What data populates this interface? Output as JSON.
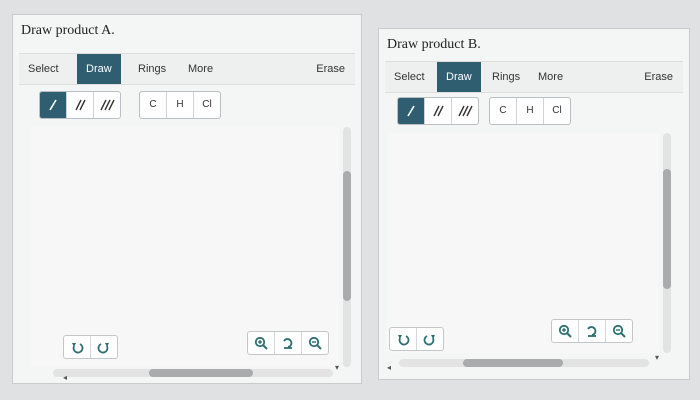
{
  "panels": [
    {
      "title": "Draw product A.",
      "tabs": [
        "Select",
        "Draw",
        "Rings",
        "More"
      ],
      "active_tab": "Draw",
      "erase": "Erase",
      "atoms": [
        "C",
        "H",
        "Cl"
      ]
    },
    {
      "title": "Draw product B.",
      "tabs": [
        "Select",
        "Draw",
        "Rings",
        "More"
      ],
      "active_tab": "Draw",
      "erase": "Erase",
      "atoms": [
        "C",
        "H",
        "Cl"
      ]
    }
  ],
  "icons": {
    "single_bond": "single-bond-icon",
    "double_bond": "double-bond-icon",
    "triple_bond": "triple-bond-icon",
    "undo": "undo-icon",
    "redo": "redo-icon",
    "zoom_in": "zoom-in-icon",
    "reset_zoom": "reset-zoom-icon",
    "zoom_out": "zoom-out-icon"
  },
  "colors": {
    "accent": "#2e5e70",
    "icon": "#2e6f72"
  }
}
